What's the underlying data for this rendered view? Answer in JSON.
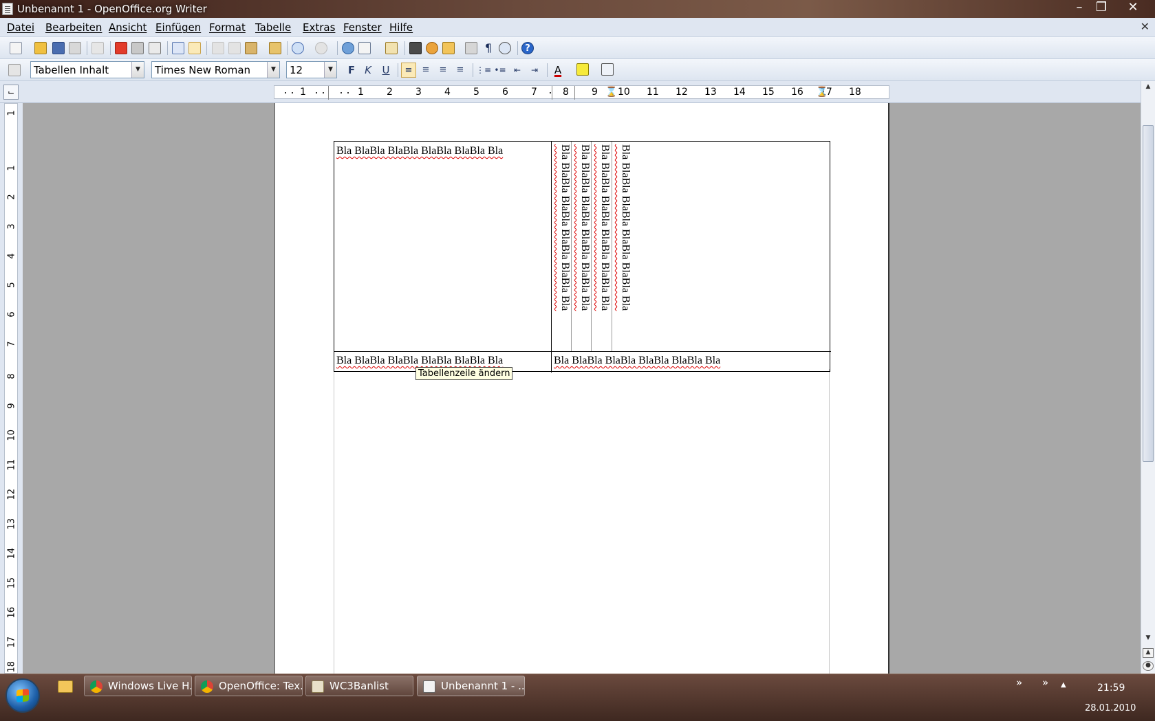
{
  "window": {
    "title": "Unbenannt 1 - OpenOffice.org Writer"
  },
  "menu": [
    "Datei",
    "Bearbeiten",
    "Ansicht",
    "Einfügen",
    "Format",
    "Tabelle",
    "Extras",
    "Fenster",
    "Hilfe"
  ],
  "formatting": {
    "paragraph_style": "Tabellen Inhalt",
    "font_name": "Times New Roman",
    "font_size": "12"
  },
  "ruler": {
    "h_numbers": [
      "1",
      "1",
      "2",
      "3",
      "4",
      "5",
      "6",
      "7",
      "8",
      "9",
      "10",
      "11",
      "12",
      "13",
      "14",
      "15",
      "16",
      "17",
      "18"
    ],
    "v_numbers": [
      "1",
      "1",
      "2",
      "3",
      "4",
      "5",
      "6",
      "7",
      "8",
      "9",
      "10",
      "11",
      "12",
      "13",
      "14",
      "15",
      "16",
      "17",
      "18"
    ]
  },
  "document": {
    "row1_left": "Bla BlaBla BlaBla BlaBla BlaBla Bla",
    "row1_vertical": [
      "Bla BlaBla BlaBla BlaBla BlaBla Bla",
      "Bla BlaBla BlaBla BlaBla BlaBla Bla",
      "Bla BlaBla BlaBla BlaBla BlaBla Bla",
      "Bla BlaBla BlaBla BlaBla BlaBla Bla"
    ],
    "row2_left": "Bla BlaBla BlaBla BlaBla BlaBla Bla",
    "row2_right": "Bla BlaBla BlaBla BlaBla BlaBla Bla"
  },
  "tooltip": "Tabellenzeile ändern",
  "taskbar": {
    "buttons": [
      "Windows Live H...",
      "OpenOffice: Tex...",
      "WC3Banlist",
      "Unbenannt 1 - ..."
    ],
    "time": "21:59",
    "date": "28.01.2010"
  }
}
